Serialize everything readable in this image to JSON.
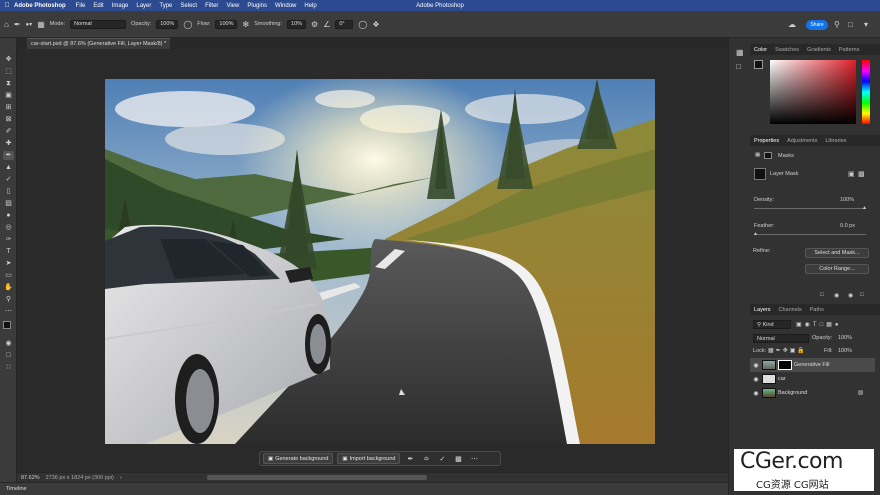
{
  "menubar": {
    "app_name": "Adobe Photoshop",
    "menus": [
      "File",
      "Edit",
      "Image",
      "Layer",
      "Type",
      "Select",
      "Filter",
      "View",
      "Plugins",
      "Window",
      "Help"
    ],
    "window_title": "Adobe Photoshop"
  },
  "options_bar": {
    "mode_label": "Mode:",
    "mode_value": "Normal",
    "opacity_label": "Opacity:",
    "opacity_value": "100%",
    "flow_label": "Flow:",
    "flow_value": "100%",
    "smoothing_label": "Smoothing:",
    "smoothing_value": "10%",
    "angle_value": "0°",
    "share_label": "Share"
  },
  "document": {
    "tab_title": "car-start.psd @ 87.6% (Generative Fill, Layer Mask/8) *"
  },
  "context_bar": {
    "generate_label": "Generate background",
    "import_label": "Import background"
  },
  "status": {
    "zoom": "87.62%",
    "doc_info": "2736 px x 1824 px (300 ppi)"
  },
  "timeline_label": "Timeline",
  "color_panel": {
    "tabs": [
      "Color",
      "Swatches",
      "Gradients",
      "Patterns"
    ]
  },
  "properties_panel": {
    "tabs": [
      "Properties",
      "Adjustments",
      "Libraries"
    ],
    "section_title": "Masks",
    "mask_label": "Layer Mask",
    "density_label": "Density:",
    "density_value": "100%",
    "feather_label": "Feather:",
    "feather_value": "0.0 px",
    "refine_label": "Refine:",
    "select_mask_button": "Select and Mask...",
    "color_range_button": "Color Range..."
  },
  "layers_panel": {
    "tabs": [
      "Layers",
      "Channels",
      "Paths"
    ],
    "filter_value": "Kind",
    "blend_value": "Normal",
    "opacity_label": "Opacity:",
    "opacity_value": "100%",
    "lock_label": "Lock:",
    "fill_label": "Fill:",
    "fill_value": "100%",
    "layers": [
      {
        "name": "Generative Fill"
      },
      {
        "name": "car"
      },
      {
        "name": "Background"
      }
    ]
  },
  "watermark": {
    "main": "CGer.com",
    "sub": "CG资源 CG网站"
  },
  "colors": {
    "menubar_bg": "#2b4a8f",
    "panel_bg": "#323232",
    "accent_blue": "#1473e6"
  }
}
